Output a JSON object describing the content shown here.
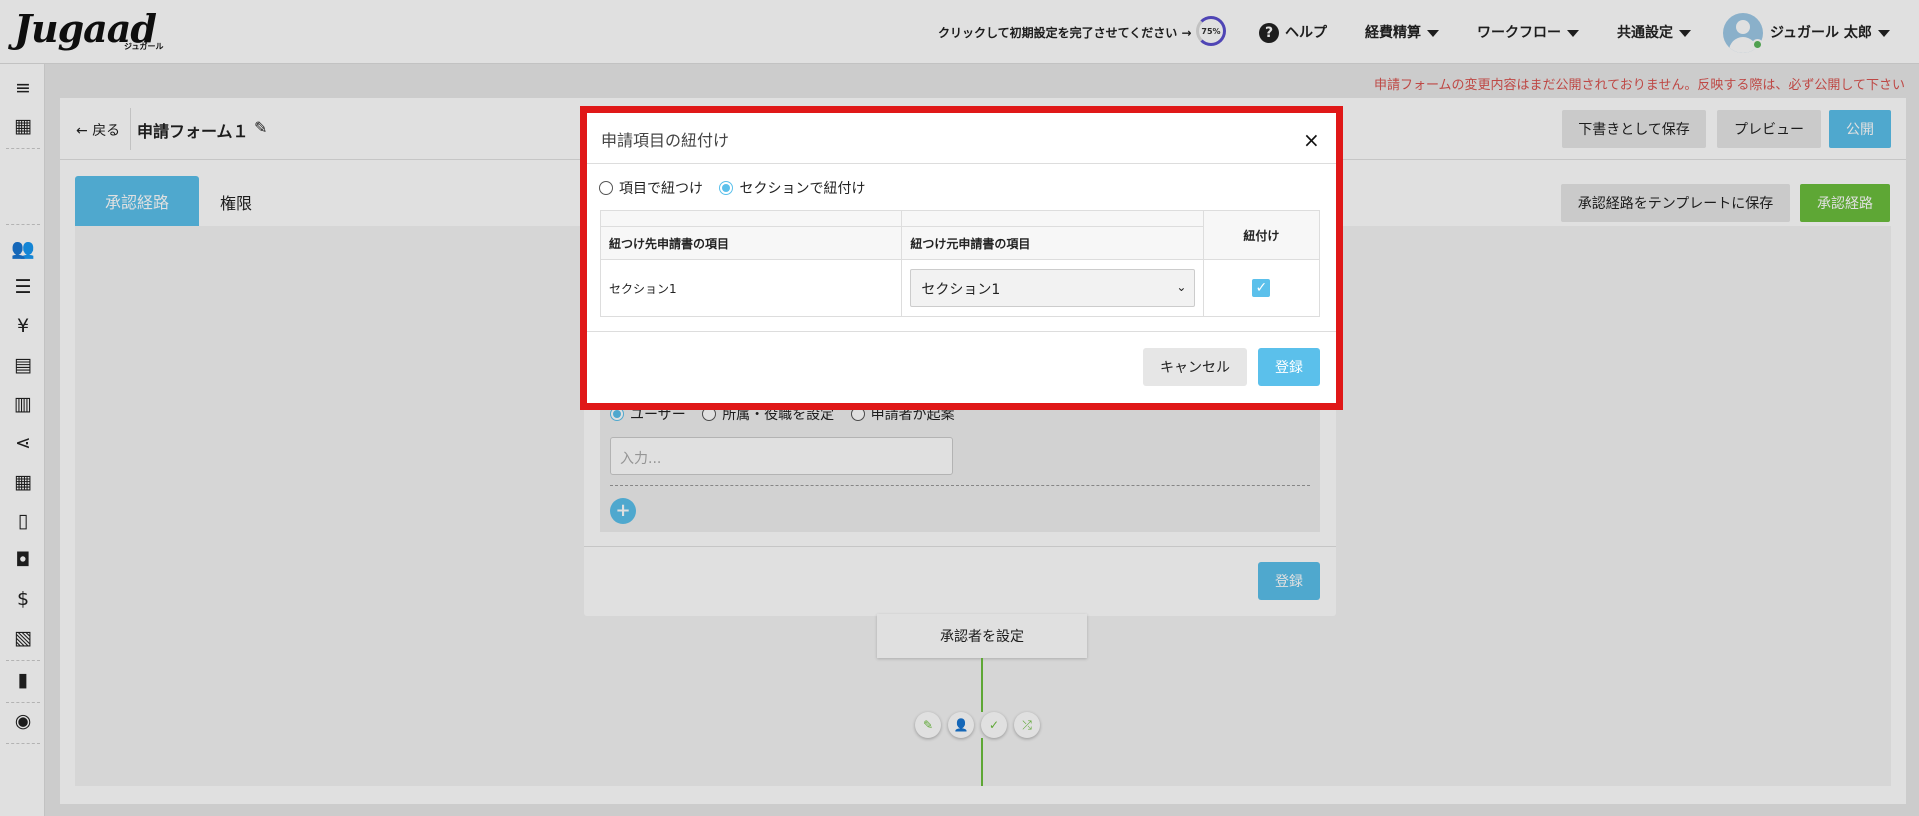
{
  "header": {
    "logo": "Jugaad",
    "logo_sub": "ジュガール",
    "setup_prompt": "クリックして初期設定を完了させてください →",
    "setup_progress": "75%",
    "help": "ヘルプ",
    "nav": [
      "経費精算",
      "ワークフロー",
      "共通設定"
    ],
    "user_name": "ジュガール 太郎"
  },
  "notice": "申請フォームの変更内容はまだ公開されておりません。反映する際は、必ず公開して下さい",
  "toolbar": {
    "back": "戻る",
    "form_title": "申請フォーム１",
    "save_draft": "下書きとして保存",
    "preview": "プレビュー",
    "publish": "公開"
  },
  "tabs": {
    "approval_route": "承認経路",
    "permission": "権限"
  },
  "route_actions": {
    "save_template": "承認経路をテンプレートに保存",
    "approval_route": "承認経路"
  },
  "background_dialog": {
    "radio_user": "ユーザー",
    "radio_dept": "所属・役職を設定",
    "radio_applicant": "申請者が起案",
    "input_placeholder": "入力...",
    "submit": "登録"
  },
  "flow": {
    "set_approver": "承認者を設定"
  },
  "modal": {
    "title": "申請項目の紐付け",
    "radio_item": "項目で紐つけ",
    "radio_section": "セクションで紐付け",
    "table": {
      "col_target": "紐つけ先申請書の項目",
      "col_source": "紐つけ元申請書の項目",
      "col_link": "紐付け",
      "rows": [
        {
          "target": "セクション1",
          "source": "セクション1",
          "linked": true
        }
      ]
    },
    "cancel": "キャンセル",
    "submit": "登録"
  },
  "colors": {
    "accent": "#5bc0eb",
    "green": "#6cbf3d",
    "highlight": "#e01818",
    "notice": "#d9534f"
  }
}
